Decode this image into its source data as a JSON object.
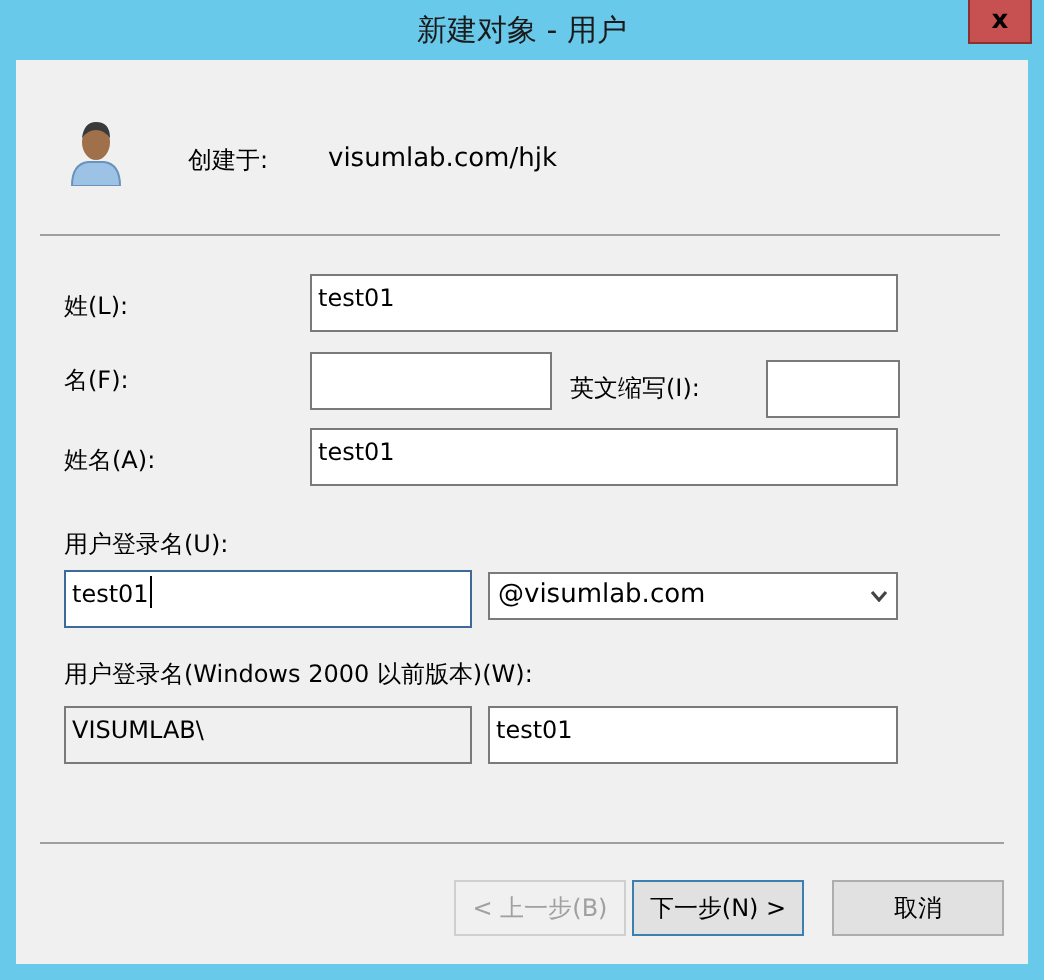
{
  "window": {
    "title": "新建对象 - 用户",
    "close_label": "x"
  },
  "created_in": {
    "label": "创建于:",
    "value": "visumlab.com/hjk"
  },
  "name_fields": [
    {
      "label": "姓(L):",
      "value": "test01"
    },
    {
      "label": "名(F):",
      "initials_label": "英文缩写(I):"
    },
    {
      "label": "姓名(A):",
      "value": "test01"
    }
  ],
  "logon": {
    "label": "用户登录名(U):",
    "value": "test01",
    "focused": true,
    "domain": "@visumlab.com"
  },
  "logon_pre2000": {
    "label": "用户登录名(Windows 2000 以前版本)(W):",
    "prefix": "VISUMLAB\\",
    "value": "test01"
  },
  "buttons": [
    {
      "label": "< 上一步(B)",
      "disabled": true,
      "default": false
    },
    {
      "label": "下一步(N) >",
      "disabled": false,
      "default": true
    },
    {
      "label": "取消",
      "disabled": false,
      "default": false
    }
  ]
}
